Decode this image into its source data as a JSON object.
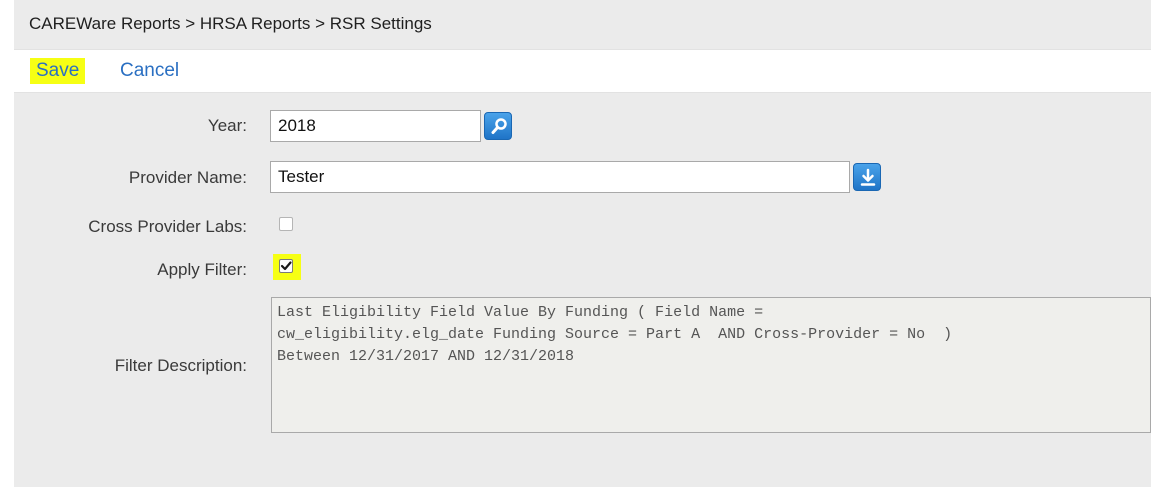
{
  "breadcrumb": "CAREWare Reports > HRSA Reports > RSR Settings",
  "toolbar": {
    "save_label": "Save",
    "cancel_label": "Cancel"
  },
  "form": {
    "year_label": "Year:",
    "year_value": "2018",
    "provider_label": "Provider Name:",
    "provider_value": "Tester",
    "cross_provider_label": "Cross Provider Labs:",
    "cross_provider_checked": false,
    "apply_filter_label": "Apply Filter:",
    "apply_filter_checked": true,
    "filter_description_label": "Filter Description:",
    "filter_description_text": "Last Eligibility Field Value By Funding ( Field Name =\ncw_eligibility.elg_date Funding Source = Part A  AND Cross-Provider = No  )\nBetween 12/31/2017 AND 12/31/2018"
  },
  "colors": {
    "highlight": "#f6ff14",
    "link": "#2a6fc2",
    "icon_blue": "#1f74c7",
    "background": "#ebebeb"
  },
  "icons": {
    "year_lookup": "search-icon",
    "provider_dropdown": "download-arrow-icon"
  }
}
